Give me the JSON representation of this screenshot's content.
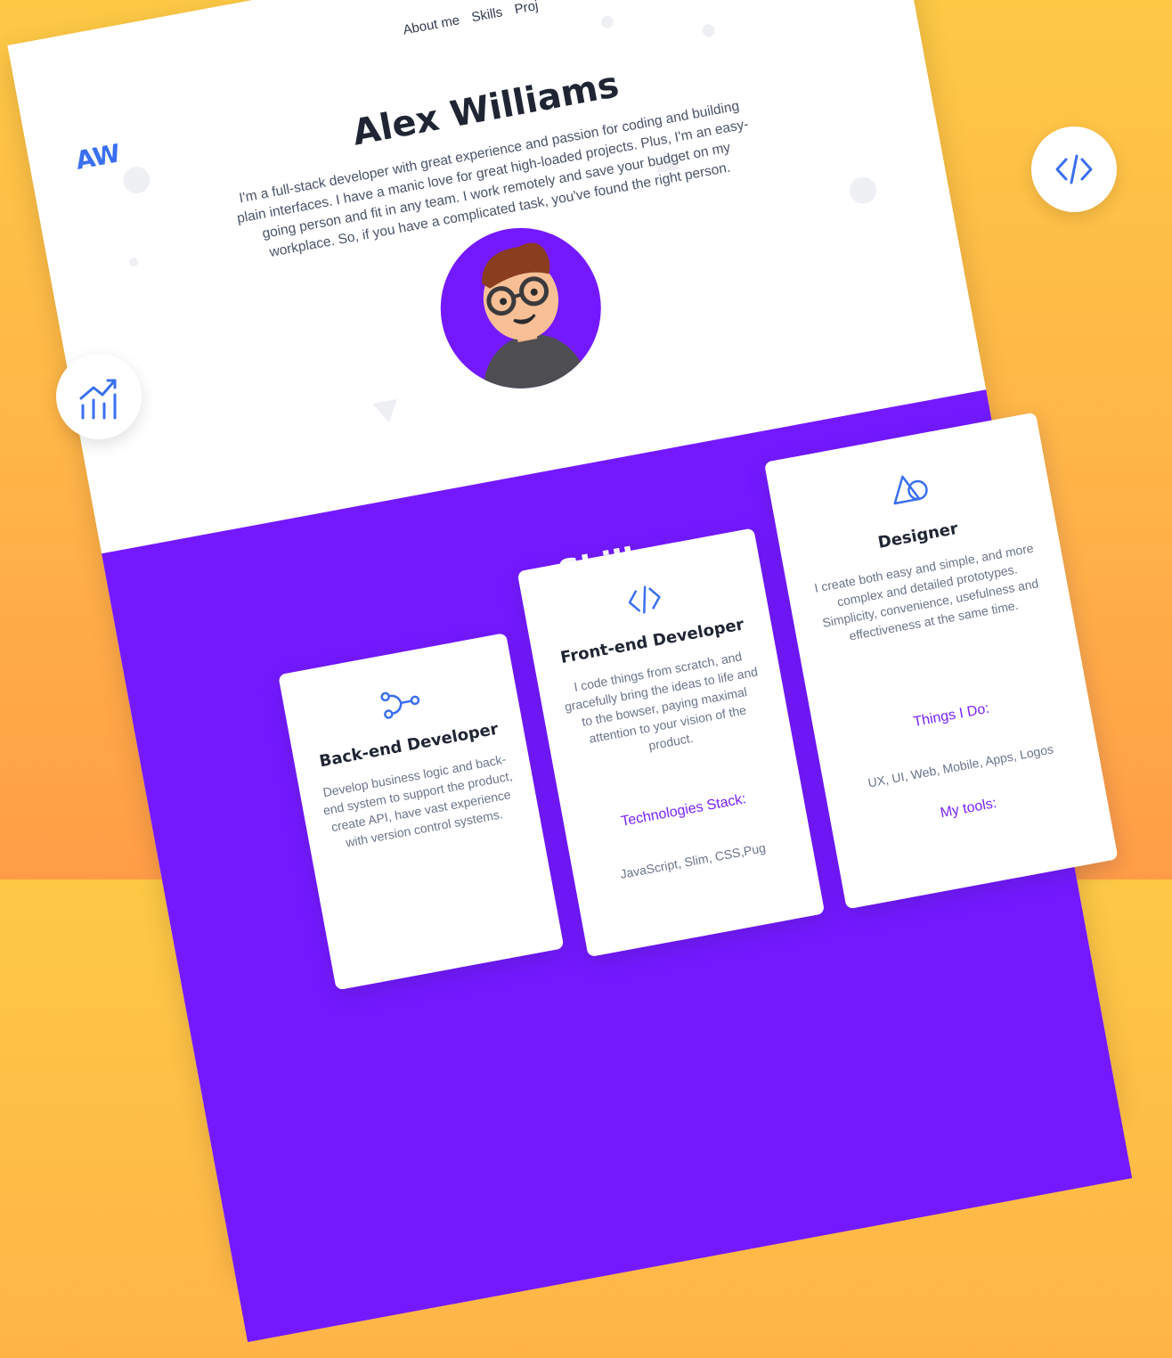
{
  "logo": "AW",
  "nav": {
    "items": [
      "About me",
      "Skills",
      "Proj"
    ]
  },
  "hero": {
    "name": "Alex Williams",
    "bio": "I'm a full-stack developer with great experience and passion for coding and building plain interfaces. I have a manic love for great high-loaded projects. Plus, I'm an easy-going person and fit in any team. I work remotely and save your budget on my workplace. So, if you have a complicated task, you've found the right person."
  },
  "skills": {
    "title": "Skills",
    "cards": [
      {
        "icon": "branch-nodes-icon",
        "title": "Back-end Developer",
        "desc": "Develop business logic and back-end system to support the product, create API, have vast experience with version control systems."
      },
      {
        "icon": "code-icon",
        "title": "Front-end Developer",
        "desc": "I code things from scratch, and gracefully bring the ideas to life and to the bowser, paying maximal attention to your vision of the product.",
        "sub": "Technologies Stack:",
        "list": "JavaScript, Slim, CSS,Pug"
      },
      {
        "icon": "shapes-icon",
        "title": "Designer",
        "desc": "I create both easy and simple, and more complex and detailed prototypes. Simplicity, convenience, usefulness and effectiveness at the same time.",
        "sub": "Things I Do:",
        "list": "UX, UI, Web, Mobile, Apps, Logos",
        "sub2": "My tools:"
      }
    ]
  },
  "badges": {
    "left": "growth-chart-icon",
    "right": "code-icon"
  },
  "colors": {
    "accent": "#7419FF",
    "brand": "#3a6ff0",
    "background": "#FDC945"
  }
}
